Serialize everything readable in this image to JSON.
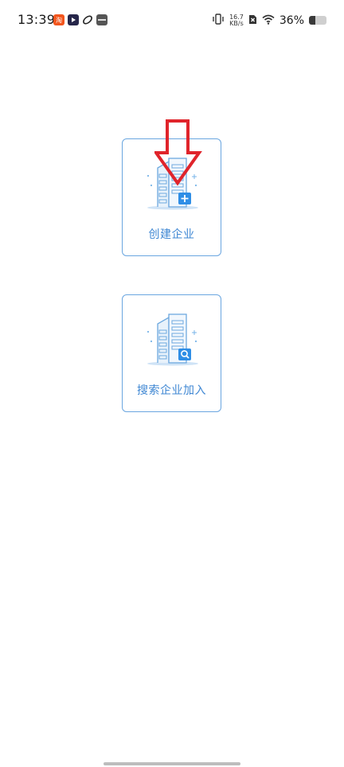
{
  "status_bar": {
    "time": "13:39",
    "net_speed_value": "16.7",
    "net_speed_unit": "KB/s",
    "battery_percent": "36%",
    "battery_level": 0.36,
    "notification_icons": [
      "taobao-icon",
      "video-app-icon",
      "link-app-icon",
      "app-icon"
    ]
  },
  "cards": {
    "create": {
      "label": "创建企业",
      "icon": "building-add-icon"
    },
    "search": {
      "label": "搜索企业加入",
      "icon": "building-search-icon"
    }
  },
  "colors": {
    "accent": "#3f87d3",
    "card_border": "#6aa6e0",
    "badge_blue": "#2f8ee6",
    "annotation_red": "#e0242b"
  }
}
